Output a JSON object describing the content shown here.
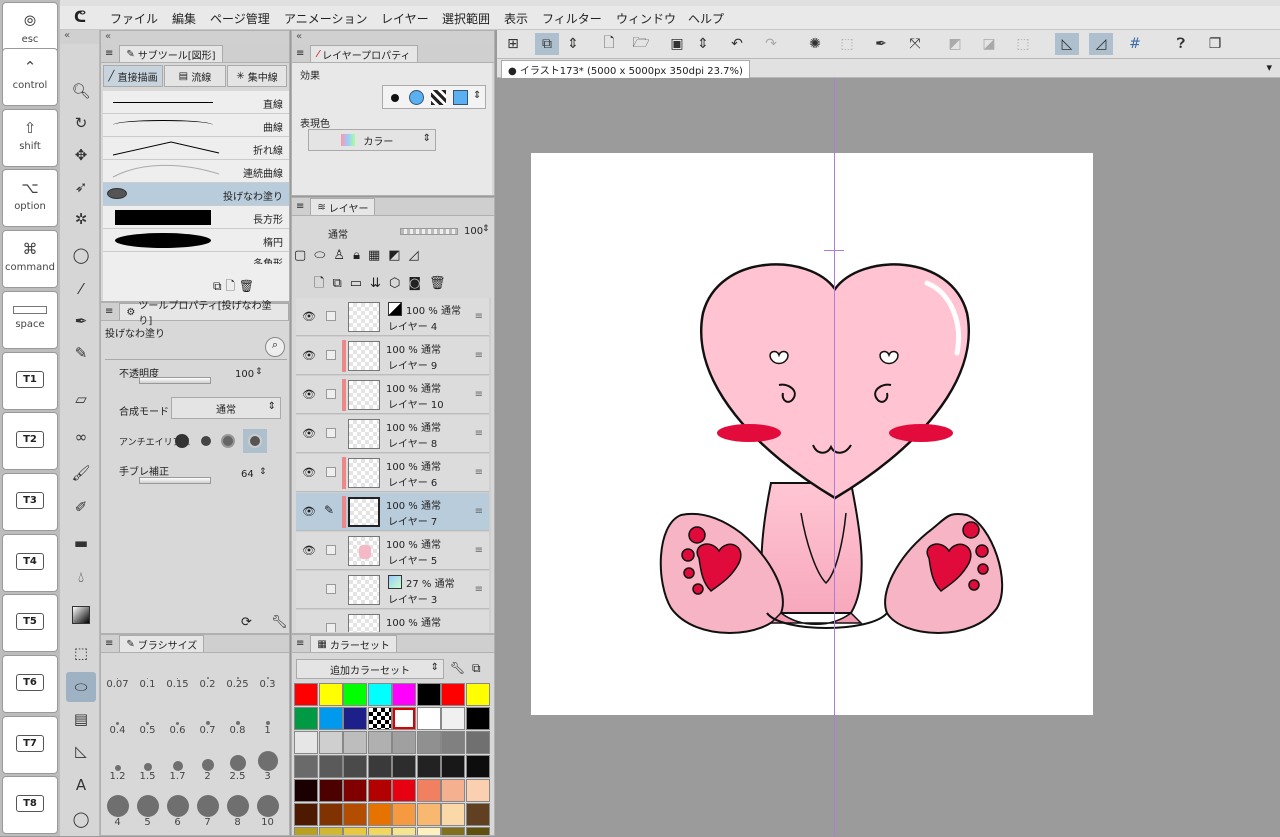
{
  "keys": [
    {
      "glyph": "⦾",
      "label": "esc"
    },
    {
      "glyph": "⌃",
      "label": "control"
    },
    {
      "glyph": "⇧",
      "label": "shift"
    },
    {
      "glyph": "⌥",
      "label": "option"
    },
    {
      "glyph": "⌘",
      "label": "command"
    },
    {
      "glyph": "",
      "label": "space"
    },
    {
      "glyph": "",
      "label": "T1"
    },
    {
      "glyph": "",
      "label": "T2"
    },
    {
      "glyph": "",
      "label": "T3"
    },
    {
      "glyph": "",
      "label": "T4"
    },
    {
      "glyph": "",
      "label": "T5"
    },
    {
      "glyph": "",
      "label": "T6"
    },
    {
      "glyph": "",
      "label": "T7"
    },
    {
      "glyph": "",
      "label": "T8"
    }
  ],
  "menu": [
    "ファイル",
    "編集",
    "ページ管理",
    "アニメーション",
    "レイヤー",
    "選択範囲",
    "表示",
    "フィルター",
    "ウィンドウ",
    "ヘルプ"
  ],
  "subtool": {
    "title": "サブツール[図形]",
    "tabs": [
      "直接描画",
      "流線",
      "集中線"
    ],
    "items": [
      "直線",
      "曲線",
      "折れ線",
      "連続曲線",
      "投げなわ塗り",
      "長方形",
      "楕円",
      "多角形"
    ]
  },
  "toolprop": {
    "title": "ツールプロパティ[投げなわ塗り]",
    "name": "投げなわ塗り",
    "opacity_label": "不透明度",
    "opacity_value": "100",
    "blend_label": "合成モード",
    "blend_value": "通常",
    "aa_label": "アンチエイリアス",
    "stab_label": "手ブレ補正",
    "stab_value": "64"
  },
  "brushsize": {
    "title": "ブラシサイズ",
    "sizes": [
      "0.07",
      "0.1",
      "0.15",
      "0.2",
      "0.25",
      "0.3",
      "0.4",
      "0.5",
      "0.6",
      "0.7",
      "0.8",
      "1",
      "1.2",
      "1.5",
      "1.7",
      "2",
      "2.5",
      "3",
      "4",
      "5",
      "6",
      "7",
      "8",
      "10"
    ]
  },
  "layerprop": {
    "title": "レイヤープロパティ",
    "effect_label": "効果",
    "color_label": "表現色",
    "color_value": "カラー"
  },
  "layers": {
    "title": "レイヤー",
    "blend": "通常",
    "opacity": "100",
    "rows": [
      {
        "op": "100 % 通常",
        "name": "レイヤー 4"
      },
      {
        "op": "100 % 通常",
        "name": "レイヤー 9"
      },
      {
        "op": "100 % 通常",
        "name": "レイヤー 10"
      },
      {
        "op": "100 % 通常",
        "name": "レイヤー 8"
      },
      {
        "op": "100 % 通常",
        "name": "レイヤー 6"
      },
      {
        "op": "100 % 通常",
        "name": "レイヤー 7"
      },
      {
        "op": "100 % 通常",
        "name": "レイヤー 5"
      },
      {
        "op": "27 % 通常",
        "name": "レイヤー 3"
      },
      {
        "op": "100 % 通常",
        "name": ""
      }
    ]
  },
  "colorset": {
    "title": "カラーセット",
    "set_name": "追加カラーセット",
    "colors": [
      "#ff0000",
      "#ffff00",
      "#00ff00",
      "#00ffff",
      "#ff00ff",
      "#000000",
      "#ff0000",
      "#ffff00",
      "#009944",
      "#0099ee",
      "#1d2088",
      "#cccccc",
      "#ffffff",
      "#ffffff",
      "#f0f0f0",
      "#000000",
      "#e6e6e6",
      "#cfcfcf",
      "#bdbdbd",
      "#b0b0b0",
      "#a0a0a0",
      "#909090",
      "#808080",
      "#707070",
      "#6a6a6a",
      "#5a5a5a",
      "#4a4a4a",
      "#3a3a3a",
      "#2d2d2d",
      "#222222",
      "#181818",
      "#0d0d0d",
      "#1a0000",
      "#4d0000",
      "#800000",
      "#b30000",
      "#e60012",
      "#f08060",
      "#f5b090",
      "#fad0b0",
      "#4d1a00",
      "#803300",
      "#b34d00",
      "#e67300",
      "#f59a40",
      "#f8b870",
      "#fbd8a8",
      "#604020",
      "#b8a020",
      "#d0b830",
      "#e8c840",
      "#f0d860",
      "#f5e590",
      "#fff0c0",
      "#807020",
      "#605010"
    ]
  },
  "doc_title": "イラスト173* (5000 x 5000px 350dpi 23.7%)",
  "accent": "#9fb2c4"
}
